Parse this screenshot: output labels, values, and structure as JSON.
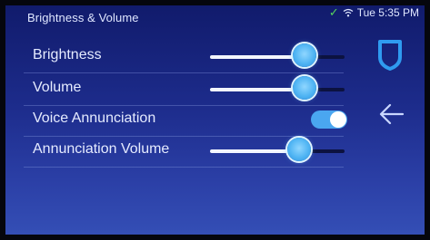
{
  "header": {
    "title": "Brightness & Volume",
    "time": "Tue 5:35 PM",
    "status_icons": [
      "check-icon",
      "wifi-icon"
    ]
  },
  "settings": [
    {
      "label": "Brightness",
      "type": "slider",
      "value_percent": 70
    },
    {
      "label": "Volume",
      "type": "slider",
      "value_percent": 70
    },
    {
      "label": "Voice Annunciation",
      "type": "toggle",
      "on": true
    },
    {
      "label": "Annunciation Volume",
      "type": "slider",
      "value_percent": 66
    }
  ],
  "side_buttons": [
    "shield-icon",
    "back-arrow-icon"
  ],
  "colors": {
    "background_top": "#101a6a",
    "background_bottom": "#3550b7",
    "accent": "#4fb4f3",
    "check": "#57d35c"
  }
}
